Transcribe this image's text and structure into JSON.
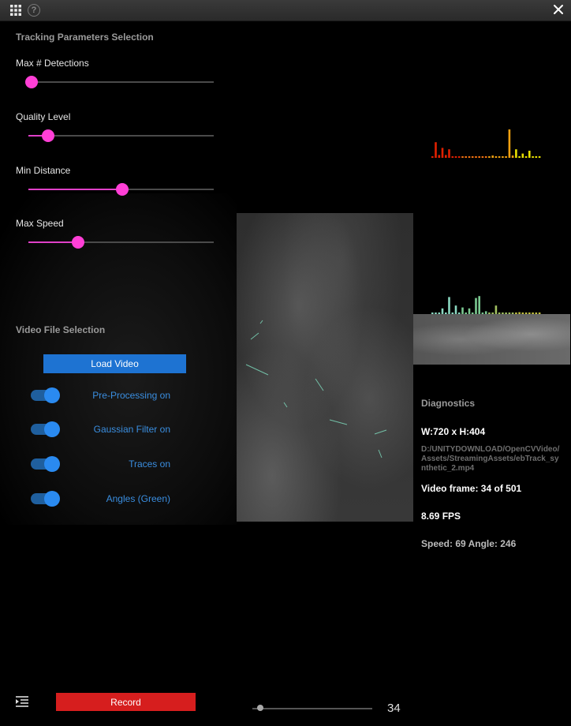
{
  "header": {
    "grid_icon": "grid-icon",
    "help_icon": "help-icon",
    "help_glyph": "?",
    "close_icon": "close-icon"
  },
  "tracking": {
    "title": "Tracking Parameters Selection",
    "sliders": [
      {
        "label": "Max # Detections",
        "value": 0.0
      },
      {
        "label": "Quality Level",
        "value": 0.09
      },
      {
        "label": "Min Distance",
        "value": 0.49
      },
      {
        "label": "Max Speed",
        "value": 0.25
      }
    ]
  },
  "video_selection": {
    "title": "Video File Selection",
    "load_label": "Load Video",
    "toggles": [
      {
        "label": "Pre-Processing on",
        "on": true
      },
      {
        "label": "Gaussian Filter on",
        "on": true
      },
      {
        "label": "Traces on",
        "on": true
      },
      {
        "label": "Angles (Green)",
        "on": true
      }
    ]
  },
  "diagnostics": {
    "title": "Diagnostics",
    "resolution": "W:720 x H:404",
    "path": "D:/UNITYDOWNLOAD/OpenCVVideo/Assets/StreamingAssets/ebTrack_synthetic_2.mp4",
    "frame": "Video frame: 34 of 501",
    "fps": "8.69 FPS",
    "speed_angle": "Speed: 69 Angle: 246"
  },
  "footer": {
    "menu_icon": "menu-collapse-icon",
    "record_label": "Record",
    "frame_value": "34",
    "frame_fraction": 0.068
  },
  "histograms": {
    "speed": {
      "values": [
        0.05,
        0.55,
        0.1,
        0.35,
        0.1,
        0.3,
        0.05,
        0.05,
        0.05,
        0.05,
        0.05,
        0.05,
        0.05,
        0.05,
        0.05,
        0.05,
        0.05,
        0.05,
        0.08,
        0.05,
        0.05,
        0.05,
        0.05,
        1.0,
        0.08,
        0.3,
        0.05,
        0.15,
        0.05,
        0.25,
        0.05,
        0.05,
        0.05
      ],
      "colors": [
        "#e02000",
        "#f07010",
        "#f0a010",
        "#e8e000"
      ]
    },
    "angle": {
      "values": [
        0.05,
        0.05,
        0.05,
        0.3,
        0.05,
        0.9,
        0.05,
        0.45,
        0.05,
        0.35,
        0.05,
        0.3,
        0.05,
        0.85,
        0.95,
        0.05,
        0.15,
        0.05,
        0.05,
        0.45,
        0.05,
        0.05,
        0.05,
        0.05,
        0.05,
        0.05,
        0.1,
        0.05,
        0.05,
        0.05,
        0.05,
        0.05,
        0.05
      ],
      "colors": [
        "#8ad8c0",
        "#7ac890",
        "#a0c060",
        "#c0c040"
      ]
    }
  }
}
